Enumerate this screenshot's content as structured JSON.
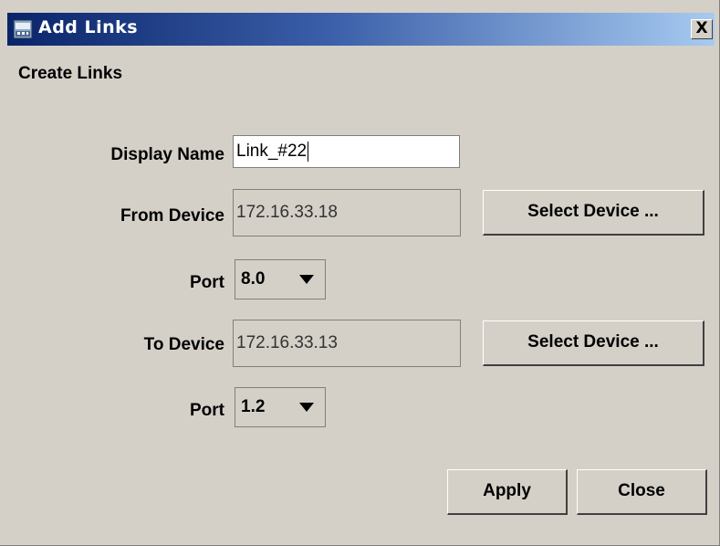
{
  "window": {
    "title": "Add Links",
    "close_label": "X"
  },
  "form": {
    "heading": "Create Links",
    "display_name": {
      "label": "Display Name",
      "value": "Link_#22"
    },
    "from_device": {
      "label": "From Device",
      "value": "172.16.33.18",
      "select_label": "Select Device ..."
    },
    "from_port": {
      "label": "Port",
      "value": "8.0"
    },
    "to_device": {
      "label": "To Device",
      "value": "172.16.33.13",
      "select_label": "Select Device ..."
    },
    "to_port": {
      "label": "Port",
      "value": "1.2"
    }
  },
  "actions": {
    "apply_label": "Apply",
    "close_label": "Close"
  },
  "icons": {
    "title_icon": "device-link-icon",
    "dropdown_icon": "chevron-down-icon"
  },
  "colors": {
    "title_gradient_start": "#0a246a",
    "title_gradient_end": "#a6caf0",
    "window_bg": "#d4d0c8"
  }
}
